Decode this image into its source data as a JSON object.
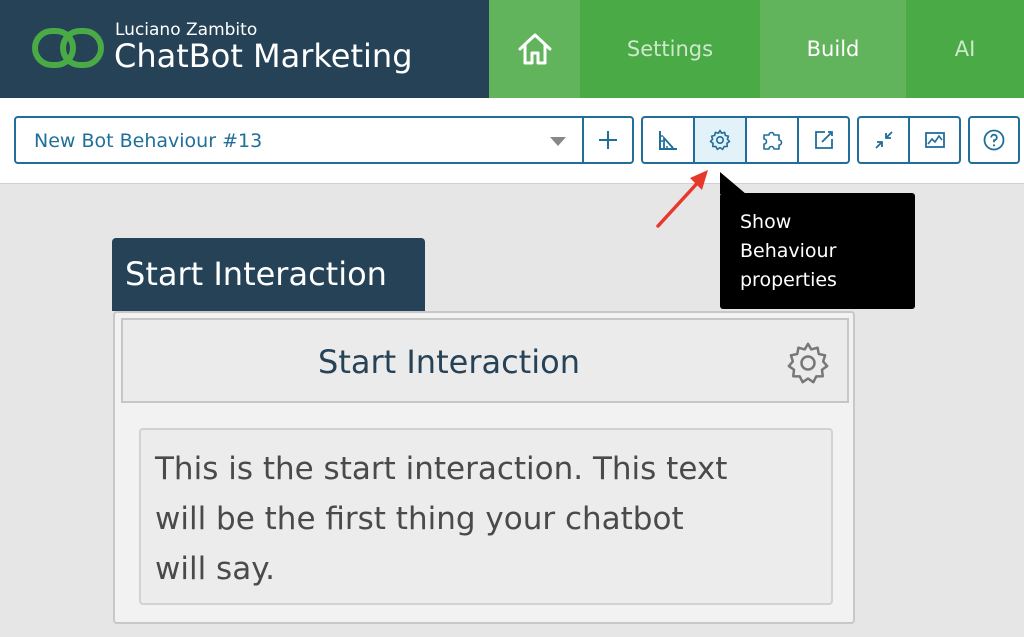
{
  "brand": {
    "owner": "Luciano Zambito",
    "app_name": "ChatBot Marketing"
  },
  "nav": {
    "home_icon": "home-icon",
    "tabs": [
      {
        "label": "Settings"
      },
      {
        "label": "Build"
      },
      {
        "label": "AI"
      }
    ],
    "active": "Build"
  },
  "toolbar": {
    "behaviour_select": {
      "value": "New Bot Behaviour #13"
    },
    "buttons": [
      {
        "icon": "plus-icon"
      },
      {
        "icon": "ruler-icon"
      },
      {
        "icon": "gear-icon",
        "active": true
      },
      {
        "icon": "puzzle-icon"
      },
      {
        "icon": "edit-icon"
      },
      {
        "icon": "collapse-icon"
      },
      {
        "icon": "chart-icon"
      },
      {
        "icon": "help-icon"
      }
    ]
  },
  "tooltip": {
    "line1": "Show",
    "line2": "Behaviour",
    "line3": "properties"
  },
  "node": {
    "tab_label": "Start Interaction",
    "title": "Start Interaction",
    "body_line1": "This is the start interaction. This text",
    "body_line2": "will be the first thing your chatbot",
    "body_line3": "will say."
  },
  "colors": {
    "header_dark": "#264257",
    "green": "#4aaa46",
    "green_light": "#61b35c",
    "accent_blue": "#1f6f9a",
    "annotation_red": "#e8372b"
  }
}
